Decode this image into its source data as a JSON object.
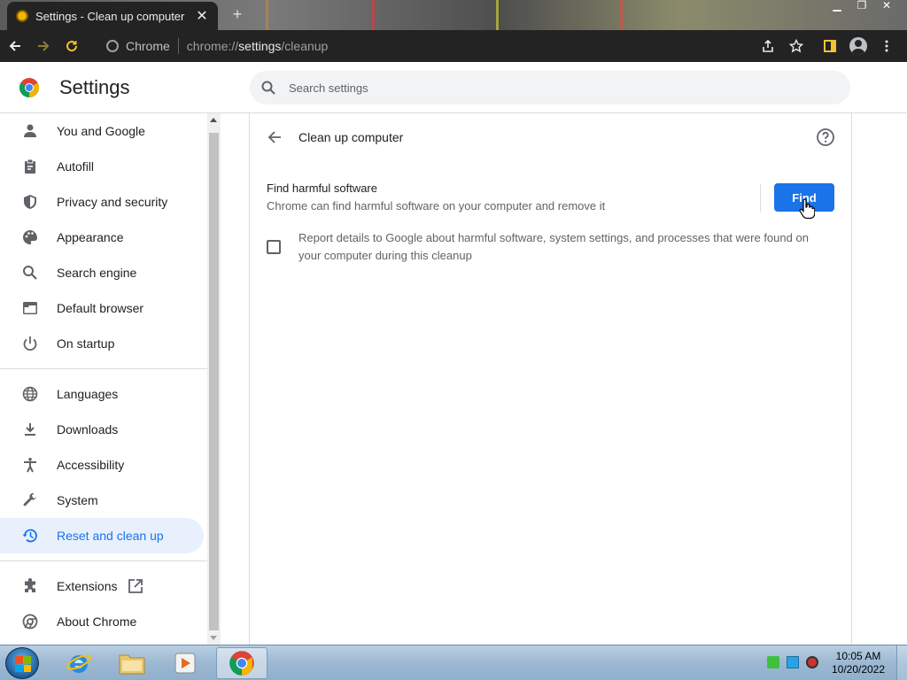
{
  "browser": {
    "tab_title": "Settings - Clean up computer",
    "tab_close": "✕",
    "new_tab": "+",
    "omnibox_chip": "Chrome",
    "url_prefix": "chrome://",
    "url_host": "settings",
    "url_path": "/cleanup"
  },
  "header": {
    "title": "Settings",
    "search_placeholder": "Search settings"
  },
  "sidebar": {
    "items": [
      {
        "label": "You and Google",
        "icon": "person-icon"
      },
      {
        "label": "Autofill",
        "icon": "clipboard-icon"
      },
      {
        "label": "Privacy and security",
        "icon": "shield-icon"
      },
      {
        "label": "Appearance",
        "icon": "palette-icon"
      },
      {
        "label": "Search engine",
        "icon": "search-icon"
      },
      {
        "label": "Default browser",
        "icon": "browser-icon"
      },
      {
        "label": "On startup",
        "icon": "power-icon"
      },
      {
        "label": "Languages",
        "icon": "globe-icon"
      },
      {
        "label": "Downloads",
        "icon": "download-icon"
      },
      {
        "label": "Accessibility",
        "icon": "accessibility-icon"
      },
      {
        "label": "System",
        "icon": "wrench-icon"
      },
      {
        "label": "Reset and clean up",
        "icon": "restore-icon",
        "active": true
      },
      {
        "label": "Extensions",
        "icon": "puzzle-icon"
      },
      {
        "label": "About Chrome",
        "icon": "chrome-icon"
      }
    ]
  },
  "main": {
    "page_title": "Clean up computer",
    "find_title": "Find harmful software",
    "find_description": "Chrome can find harmful software on your computer and remove it",
    "find_button": "Find",
    "report_label": "Report details to Google about harmful software, system settings, and processes that were found on your computer during this cleanup",
    "report_checked": false
  },
  "taskbar": {
    "time": "10:05 AM",
    "date": "10/20/2022"
  },
  "colors": {
    "accent": "#1a73e8",
    "active_nav_bg": "#e8f0fe",
    "chrome_dark": "#232323"
  }
}
